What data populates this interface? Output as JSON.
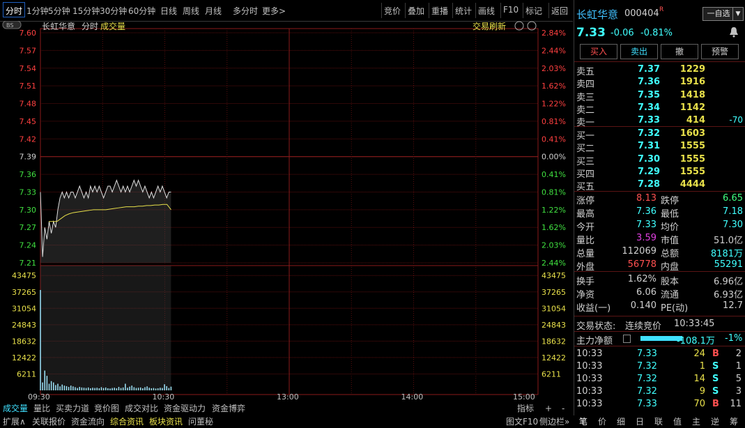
{
  "toolbar": {
    "periods": [
      "分时",
      "1分钟",
      "5分钟",
      "15分钟",
      "30分钟",
      "60分钟",
      "日线",
      "周线",
      "月线",
      "多分时",
      "更多>"
    ],
    "tools": [
      "竞价",
      "叠加",
      "重播",
      "统计",
      "画线",
      "F10",
      "标记",
      "返回"
    ]
  },
  "chart_header": {
    "name": "长虹华意",
    "mode": "分时",
    "indicator": "成交量",
    "refresh": "交易刷新",
    "bs_badge": "BS"
  },
  "chart_data": {
    "type": "line",
    "prev_close": 7.39,
    "price_ticks": [
      7.6,
      7.57,
      7.54,
      7.51,
      7.48,
      7.45,
      7.42,
      7.39,
      7.36,
      7.33,
      7.3,
      7.27,
      7.24,
      7.21
    ],
    "pct_ticks": [
      "2.84%",
      "2.44%",
      "2.03%",
      "1.62%",
      "1.22%",
      "0.81%",
      "0.41%",
      "0.00%",
      "0.41%",
      "0.81%",
      "1.22%",
      "1.62%",
      "2.03%",
      "2.44%"
    ],
    "volume_ticks": [
      43475,
      37265,
      31054,
      24843,
      18632,
      12422,
      6211
    ],
    "time_labels": [
      "09:30",
      "10:30",
      "13:00",
      "14:00",
      "15:00"
    ],
    "price_series": [
      7.33,
      7.22,
      7.27,
      7.25,
      7.28,
      7.26,
      7.28,
      7.27,
      7.3,
      7.32,
      7.33,
      7.32,
      7.33,
      7.32,
      7.33,
      7.33,
      7.32,
      7.33,
      7.34,
      7.33,
      7.32,
      7.33,
      7.32,
      7.34,
      7.33,
      7.34,
      7.33,
      7.34,
      7.33,
      7.32,
      7.33,
      7.34,
      7.34,
      7.33,
      7.34,
      7.35,
      7.34,
      7.33,
      7.34,
      7.33,
      7.34,
      7.33,
      7.34,
      7.35,
      7.34,
      7.35,
      7.34,
      7.33,
      7.34,
      7.33,
      7.32,
      7.33,
      7.32,
      7.33,
      7.34,
      7.33,
      7.34,
      7.33,
      7.32,
      7.33,
      7.33
    ],
    "avg_series": [
      7.28,
      7.28,
      7.28,
      7.285,
      7.29,
      7.293,
      7.295,
      7.296,
      7.297,
      7.298,
      7.299,
      7.3,
      7.3,
      7.3,
      7.3,
      7.301,
      7.302,
      7.303,
      7.304,
      7.305,
      7.305,
      7.305,
      7.306,
      7.306,
      7.307,
      7.307,
      7.308,
      7.308,
      7.309,
      7.309,
      7.3
    ],
    "volume_series": [
      38000,
      3000,
      7500,
      5500,
      2500,
      3500,
      3000,
      2000,
      2500,
      1500,
      2200,
      1800,
      1600,
      1300,
      1800,
      1500,
      1200,
      900,
      1300,
      1100,
      1000,
      900,
      1100,
      800,
      1000,
      900,
      1000,
      800,
      1200,
      900,
      1100,
      800,
      700,
      900,
      1000,
      800,
      1300,
      900,
      1100,
      2500,
      1000,
      1400,
      1800,
      1200,
      900,
      1000,
      1100,
      800,
      1200,
      1500,
      1000,
      800,
      900,
      700,
      800,
      1000,
      900,
      2300,
      1600,
      900,
      1400
    ],
    "total_minutes": 240
  },
  "quote": {
    "name": "长虹华意",
    "code": "000404",
    "flag": "R",
    "price": "7.33",
    "change": "-0.06",
    "pct": "-0.81%",
    "self_select": "一自选"
  },
  "actions": [
    "买入",
    "卖出",
    "撤",
    "预警"
  ],
  "asks": [
    {
      "label": "卖五",
      "price": "7.37",
      "vol": "1229",
      "chg": ""
    },
    {
      "label": "卖四",
      "price": "7.36",
      "vol": "1916",
      "chg": ""
    },
    {
      "label": "卖三",
      "price": "7.35",
      "vol": "1418",
      "chg": ""
    },
    {
      "label": "卖二",
      "price": "7.34",
      "vol": "1142",
      "chg": ""
    },
    {
      "label": "卖一",
      "price": "7.33",
      "vol": "414",
      "chg": "-70"
    }
  ],
  "bids": [
    {
      "label": "买一",
      "price": "7.32",
      "vol": "1603"
    },
    {
      "label": "买二",
      "price": "7.31",
      "vol": "1555"
    },
    {
      "label": "买三",
      "price": "7.30",
      "vol": "1555"
    },
    {
      "label": "买四",
      "price": "7.29",
      "vol": "1555"
    },
    {
      "label": "买五",
      "price": "7.28",
      "vol": "4444"
    }
  ],
  "stats1": [
    {
      "l1": "涨停",
      "v1": "8.13",
      "l2": "跌停",
      "v2": "6.65"
    },
    {
      "l1": "最高",
      "v1": "7.36",
      "l2": "最低",
      "v2": "7.18"
    },
    {
      "l1": "今开",
      "v1": "7.33",
      "l2": "均价",
      "v2": "7.30"
    },
    {
      "l1": "量比",
      "v1": "3.59",
      "l2": "市值",
      "v2": "51.0亿"
    },
    {
      "l1": "总量",
      "v1": "112069",
      "l2": "总额",
      "v2": "8181万"
    },
    {
      "l1": "外盘",
      "v1": "56778",
      "l2": "内盘",
      "v2": "55291"
    }
  ],
  "stats2": [
    {
      "l1": "换手",
      "v1": "1.62%",
      "l2": "股本",
      "v2": "6.96亿"
    },
    {
      "l1": "净资",
      "v1": "6.06",
      "l2": "流通",
      "v2": "6.93亿"
    },
    {
      "l1": "收益(一)",
      "v1": "0.140",
      "l2": "PE(动)",
      "v2": "12.7"
    }
  ],
  "trade_status": {
    "label": "交易状态:",
    "value": "连续竞价",
    "time": "10:33:45"
  },
  "main_flow": {
    "label": "主力净额",
    "value": "-108.1万",
    "pct": "-1%"
  },
  "ticks": [
    {
      "time": "10:33",
      "price": "7.33",
      "vol": "24",
      "side": "B",
      "n": "2"
    },
    {
      "time": "10:33",
      "price": "7.32",
      "vol": "1",
      "side": "S",
      "n": "1"
    },
    {
      "time": "10:33",
      "price": "7.32",
      "vol": "14",
      "side": "S",
      "n": "5"
    },
    {
      "time": "10:33",
      "price": "7.32",
      "vol": "9",
      "side": "S",
      "n": "3"
    },
    {
      "time": "10:33",
      "price": "7.33",
      "vol": "70",
      "side": "B",
      "n": "11"
    }
  ],
  "bottom_tabs1": [
    "成交量",
    "量比",
    "买卖力道",
    "竞价图",
    "成交对比",
    "资金驱动力",
    "资金博弈"
  ],
  "bottom_right1": [
    "指标",
    "+",
    "-"
  ],
  "bottom_tabs2": [
    "扩展∧",
    "关联报价",
    "资金流向",
    "综合资讯",
    "板块资讯",
    "问董秘"
  ],
  "bottom_right2": [
    "图文F10",
    "侧边栏»"
  ],
  "right_bottom_tabs": [
    "笔",
    "价",
    "细",
    "日",
    "联",
    "值",
    "主",
    "逆",
    "筹"
  ]
}
